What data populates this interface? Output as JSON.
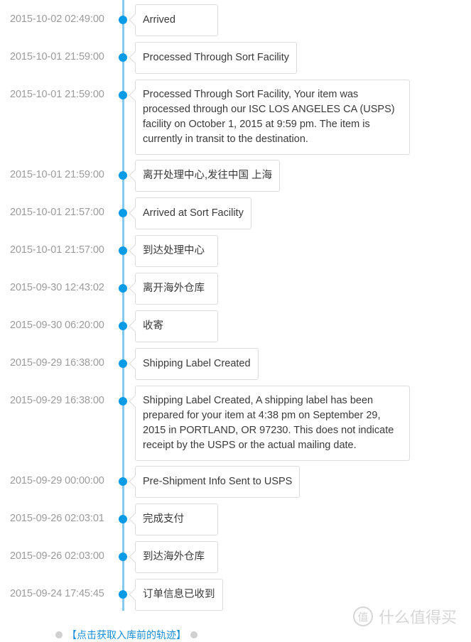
{
  "timeline": {
    "events": [
      {
        "time": "2015-10-02 02:49:00",
        "text": "Arrived",
        "multi": false
      },
      {
        "time": "2015-10-01 21:59:00",
        "text": "Processed Through Sort Facility",
        "multi": false
      },
      {
        "time": "2015-10-01 21:59:00",
        "text": "Processed Through Sort Facility, Your item was processed through our ISC LOS ANGELES CA (USPS) facility on October 1, 2015 at 9:59 pm. The item is currently in transit to the destination.",
        "multi": true
      },
      {
        "time": "2015-10-01 21:59:00",
        "text": "离开处理中心,发往中国 上海",
        "multi": false
      },
      {
        "time": "2015-10-01 21:57:00",
        "text": "Arrived at Sort Facility",
        "multi": false
      },
      {
        "time": "2015-10-01 21:57:00",
        "text": "到达处理中心",
        "multi": false
      },
      {
        "time": "2015-09-30 12:43:02",
        "text": "离开海外仓库",
        "multi": false
      },
      {
        "time": "2015-09-30 06:20:00",
        "text": "收寄",
        "multi": false
      },
      {
        "time": "2015-09-29 16:38:00",
        "text": "Shipping Label Created",
        "multi": false
      },
      {
        "time": "2015-09-29 16:38:00",
        "text": "Shipping Label Created, A shipping label has been prepared for your item at 4:38 pm on September 29, 2015 in PORTLAND, OR 97230. This does not indicate receipt by the USPS or the actual mailing date.",
        "multi": true
      },
      {
        "time": "2015-09-29 00:00:00",
        "text": "Pre-Shipment Info Sent to USPS",
        "multi": false
      },
      {
        "time": "2015-09-26 02:03:01",
        "text": "完成支付",
        "multi": false
      },
      {
        "time": "2015-09-26 02:03:00",
        "text": "到达海外仓库",
        "multi": false
      },
      {
        "time": "2015-09-24 17:45:45",
        "text": "订单信息已收到",
        "multi": false
      }
    ]
  },
  "footer": {
    "link_label": "【点击获取入库前的轨迹】"
  },
  "watermark": {
    "logo_char": "值",
    "text": "什么值得买"
  },
  "colors": {
    "accent": "#0a9be6",
    "line": "#86c9ef",
    "time_text": "#9b9b9b",
    "box_border": "#dcdcdc",
    "link": "#1a8fd8"
  }
}
